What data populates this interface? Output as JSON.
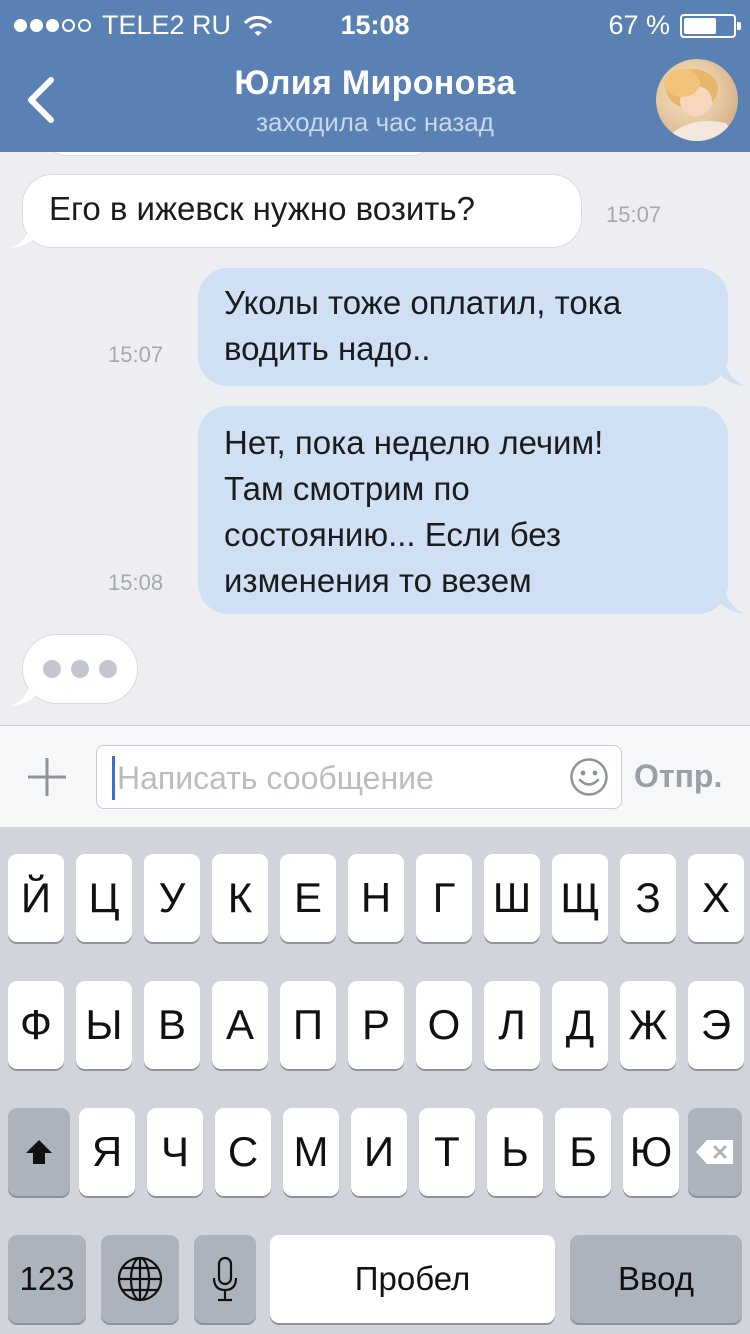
{
  "status_bar": {
    "carrier": "TELE2 RU",
    "time": "15:08",
    "battery": "67 %",
    "battery_level": 0.67
  },
  "header": {
    "title": "Юлия Миронова",
    "subtitle": "заходила час назад"
  },
  "messages": [
    {
      "direction": "in",
      "lines": [
        "Его в ижевск нужно возить?"
      ],
      "time": "15:07"
    },
    {
      "direction": "out",
      "lines": [
        "Уколы тоже оплатил, тока",
        "водить надо.."
      ],
      "time": "15:07"
    },
    {
      "direction": "out",
      "lines": [
        "Нет, пока неделю лечим!",
        "Там смотрим по",
        "состоянию... Если без",
        "изменения то везем"
      ],
      "time": "15:08"
    }
  ],
  "composer": {
    "placeholder": "Написать сообщение",
    "send_label": "Отпр."
  },
  "keyboard": {
    "row1": [
      "Й",
      "Ц",
      "У",
      "К",
      "Е",
      "Н",
      "Г",
      "Ш",
      "Щ",
      "З",
      "Х"
    ],
    "row2": [
      "Ф",
      "Ы",
      "В",
      "А",
      "П",
      "Р",
      "О",
      "Л",
      "Д",
      "Ж",
      "Э"
    ],
    "row3": [
      "Я",
      "Ч",
      "С",
      "М",
      "И",
      "Т",
      "Ь",
      "Б",
      "Ю"
    ],
    "numbers_label": "123",
    "space_label": "Пробел",
    "return_label": "Ввод"
  }
}
